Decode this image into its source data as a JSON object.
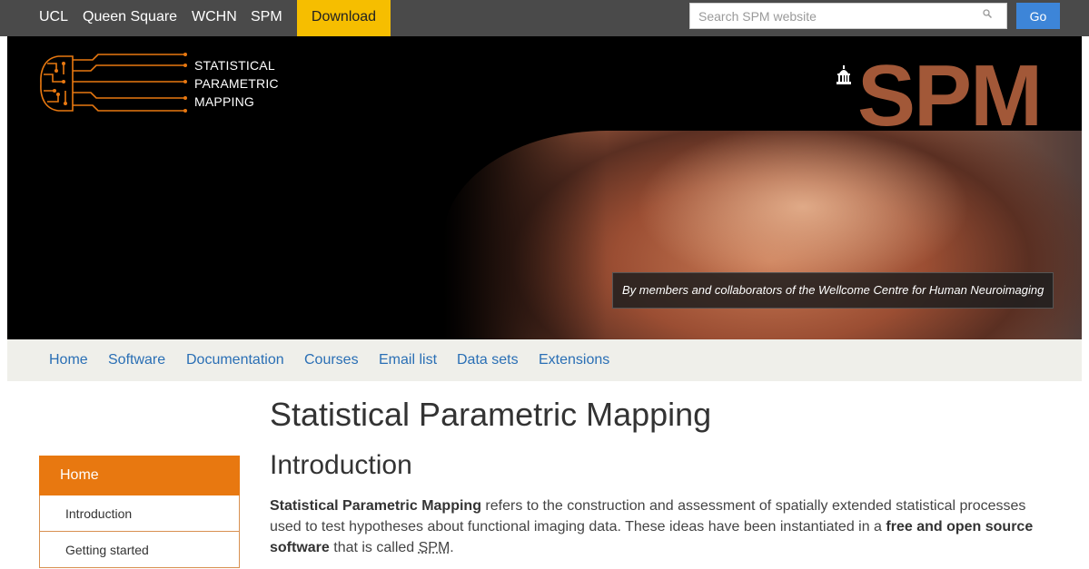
{
  "topbar": {
    "links": [
      "UCL",
      "Queen Square",
      "WCHN",
      "SPM"
    ],
    "download_label": "Download",
    "search_placeholder": "Search SPM website",
    "go_label": "Go"
  },
  "banner": {
    "logo_lines": [
      "STATISTICAL",
      "PARAMETRIC",
      "MAPPING"
    ],
    "big_title": "SPM",
    "caption": "By members and collaborators of the Wellcome Centre for Human Neuroimaging"
  },
  "nav": {
    "items": [
      "Home",
      "Software",
      "Documentation",
      "Courses",
      "Email list",
      "Data sets",
      "Extensions"
    ]
  },
  "sidebar": {
    "active": "Home",
    "items": [
      "Introduction",
      "Getting started"
    ]
  },
  "main": {
    "title": "Statistical Parametric Mapping",
    "section": "Introduction",
    "intro_bold_1": "Statistical Parametric Mapping",
    "intro_text_1": " refers to the construction and assessment of spatially extended statistical processes used to test hypotheses about functional imaging data. These ideas have been instantiated in a ",
    "intro_bold_2": "free and open source software",
    "intro_text_2": " that is called ",
    "intro_abbr": "SPM",
    "intro_text_3": "."
  },
  "colors": {
    "topbar_bg": "#4a4a4a",
    "download_bg": "#f6be00",
    "go_bg": "#3d85d8",
    "accent_orange": "#e87810",
    "nav_link": "#2a6fb5"
  }
}
